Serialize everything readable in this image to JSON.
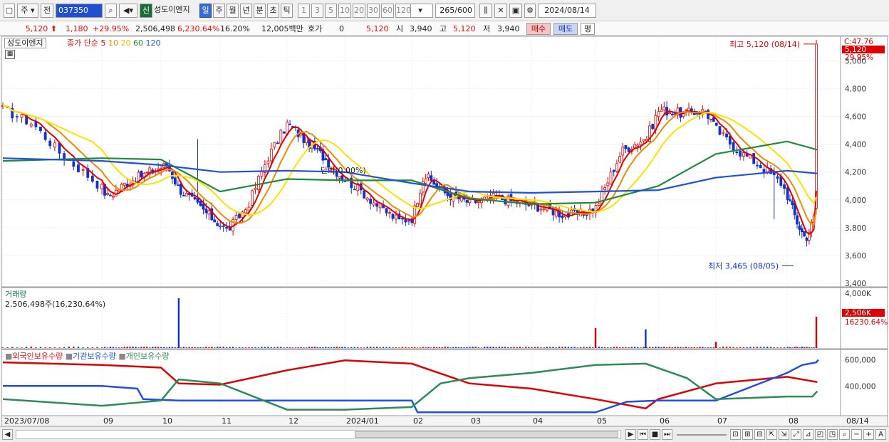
{
  "toolbar": {
    "type_label": "주",
    "prev_label": "전",
    "code_value": "037350",
    "new_badge": "신",
    "stock_name": "성도이엔지",
    "periods": [
      "일",
      "주",
      "월",
      "년",
      "분",
      "초",
      "틱"
    ],
    "active_period": "일",
    "intervals": [
      "1",
      "3",
      "5",
      "10",
      "20",
      "30",
      "60",
      "120"
    ],
    "count_value": "265",
    "count_total": "/600",
    "date_value": "2024/08/14"
  },
  "quote": {
    "price": "5,120",
    "change": "1,180",
    "change_pct": "+29.95%",
    "volume": "2,506,498",
    "volume_pct": "6,230.64%",
    "turnover": "16.20%",
    "amount": "12,005백만",
    "hoga_label": "호가",
    "hoga_value": "0",
    "hoga_price": "5,120",
    "open_label": "시",
    "open_value": "3,940",
    "high_label": "고",
    "high_value": "5,120",
    "low_label": "저",
    "low_value": "3,940",
    "buy_label": "매수",
    "sell_label": "매도",
    "avg_label": "평"
  },
  "price_panel": {
    "name_tag": "성도이엔지",
    "ma_prefix": "종가 단순",
    "ma_periods": [
      "5",
      "10",
      "20",
      "60",
      "120"
    ],
    "ma_colors": [
      "#e00000",
      "#f08a00",
      "#ffe000",
      "#1f8a3a",
      "#2050e0"
    ],
    "top_right_label": "C:47.76",
    "current_price_tag": "5,120",
    "current_pct_tag": "29.95%",
    "high_annotation": "최고 5,120 (08/14)",
    "low_annotation": "최저 3,465 (08/05)",
    "mid_annotation": "단락(0.00%)"
  },
  "volume_panel": {
    "label": "거래량",
    "info": "2,506,498주(16,230.64%)",
    "axis_label": "4,000K",
    "current_tag": "2,506K",
    "current_pct": "16230.64%"
  },
  "holding_panel": {
    "legend": [
      "외국인보유수량",
      "기관보유수량",
      "개인보유수량"
    ],
    "colors": [
      "#e00000",
      "#2050e0",
      "#2e8b57"
    ],
    "axis_labels": [
      "600,000",
      "400,000"
    ]
  },
  "x_axis": {
    "labels": [
      "2023/07/08",
      "09",
      "10",
      "11",
      "12",
      "2024/01",
      "02",
      "03",
      "04",
      "05",
      "06",
      "07",
      "08",
      "08/14"
    ]
  },
  "chart_data": {
    "type": "candlestick",
    "price_axis": {
      "ticks": [
        3400,
        3600,
        3800,
        4000,
        4200,
        4400,
        4600,
        4800,
        5000
      ],
      "ylim": [
        3380,
        5150
      ]
    },
    "months": [
      "2023/07/08",
      "09",
      "10",
      "11",
      "12",
      "2024/01",
      "02",
      "03",
      "04",
      "05",
      "06",
      "07",
      "08"
    ],
    "close_path": [
      [
        0,
        4650
      ],
      [
        0.3,
        4550
      ],
      [
        0.6,
        4320
      ],
      [
        0.9,
        4150
      ],
      [
        1.1,
        4020
      ],
      [
        1.4,
        4120
      ],
      [
        1.8,
        4200
      ],
      [
        2.1,
        4250
      ],
      [
        2.3,
        4080
      ],
      [
        2.7,
        3930
      ],
      [
        3.1,
        3780
      ],
      [
        3.4,
        3950
      ],
      [
        3.7,
        4300
      ],
      [
        4.0,
        4550
      ],
      [
        4.3,
        4430
      ],
      [
        4.6,
        4320
      ],
      [
        4.9,
        4180
      ],
      [
        5.2,
        4080
      ],
      [
        5.5,
        3950
      ],
      [
        5.8,
        3850
      ],
      [
        6.0,
        3870
      ],
      [
        6.2,
        4180
      ],
      [
        6.6,
        4040
      ],
      [
        7.0,
        3980
      ],
      [
        7.4,
        4020
      ],
      [
        7.8,
        3980
      ],
      [
        8.2,
        3940
      ],
      [
        8.5,
        3890
      ],
      [
        8.8,
        3900
      ],
      [
        9.0,
        3950
      ],
      [
        9.4,
        4350
      ],
      [
        9.8,
        4450
      ],
      [
        10.0,
        4650
      ],
      [
        10.4,
        4620
      ],
      [
        10.8,
        4640
      ],
      [
        11.0,
        4500
      ],
      [
        11.3,
        4350
      ],
      [
        11.6,
        4250
      ],
      [
        11.9,
        4120
      ],
      [
        12.2,
        3820
      ],
      [
        12.35,
        3720
      ],
      [
        12.5,
        3850
      ],
      [
        12.55,
        3940
      ],
      [
        12.58,
        5120
      ]
    ],
    "ma120_path": [
      [
        0,
        4300
      ],
      [
        1,
        4280
      ],
      [
        2,
        4250
      ],
      [
        3,
        4200
      ],
      [
        4,
        4210
      ],
      [
        5,
        4200
      ],
      [
        6,
        4120
      ],
      [
        7,
        4060
      ],
      [
        8,
        4050
      ],
      [
        9,
        4060
      ],
      [
        10,
        4070
      ],
      [
        11,
        4160
      ],
      [
        12,
        4210
      ],
      [
        12.6,
        4190
      ]
    ],
    "ma60_path": [
      [
        0,
        4280
      ],
      [
        1,
        4300
      ],
      [
        2,
        4290
      ],
      [
        3,
        4060
      ],
      [
        4,
        4150
      ],
      [
        5,
        4140
      ],
      [
        6,
        4140
      ],
      [
        7,
        4010
      ],
      [
        8,
        3970
      ],
      [
        9,
        3980
      ],
      [
        10,
        4100
      ],
      [
        11,
        4330
      ],
      [
        12,
        4420
      ],
      [
        12.6,
        4360
      ]
    ],
    "volume_spikes": [
      {
        "x": 2.3,
        "value": 4000,
        "color": "blue"
      },
      {
        "x": 9.0,
        "value": 1600,
        "color": "red"
      },
      {
        "x": 9.8,
        "value": 1500,
        "color": "blue"
      },
      {
        "x": 11.0,
        "value": 500,
        "color": "red"
      },
      {
        "x": 12.58,
        "value": 2506,
        "color": "red"
      }
    ],
    "foreign_holding": [
      [
        0,
        580000
      ],
      [
        1,
        560000
      ],
      [
        2,
        540000
      ],
      [
        2.3,
        420000
      ],
      [
        3,
        410000
      ],
      [
        4,
        520000
      ],
      [
        5,
        595000
      ],
      [
        6,
        570000
      ],
      [
        7,
        420000
      ],
      [
        8,
        380000
      ],
      [
        9,
        300000
      ],
      [
        9.8,
        230000
      ],
      [
        10,
        300000
      ],
      [
        11,
        420000
      ],
      [
        12,
        470000
      ],
      [
        12.6,
        430000
      ]
    ],
    "institution_holding": [
      [
        0,
        400000
      ],
      [
        1,
        400000
      ],
      [
        1.6,
        380000
      ],
      [
        1.7,
        300000
      ],
      [
        2.3,
        290000
      ],
      [
        6.0,
        290000
      ],
      [
        6.1,
        200000
      ],
      [
        9.0,
        200000
      ],
      [
        9.5,
        280000
      ],
      [
        10.0,
        290000
      ],
      [
        11.0,
        290000
      ],
      [
        12.0,
        500000
      ],
      [
        12.3,
        560000
      ],
      [
        12.58,
        580000
      ],
      [
        12.62,
        600000
      ]
    ],
    "retail_holding": [
      [
        0,
        300000
      ],
      [
        1,
        250000
      ],
      [
        2,
        290000
      ],
      [
        2.3,
        450000
      ],
      [
        3,
        420000
      ],
      [
        4,
        220000
      ],
      [
        5,
        220000
      ],
      [
        6,
        240000
      ],
      [
        6.5,
        420000
      ],
      [
        7,
        460000
      ],
      [
        8,
        500000
      ],
      [
        9,
        560000
      ],
      [
        9.8,
        570000
      ],
      [
        10.5,
        460000
      ],
      [
        11.0,
        300000
      ],
      [
        11.5,
        310000
      ],
      [
        12.0,
        320000
      ],
      [
        12.5,
        320000
      ],
      [
        12.6,
        360000
      ]
    ]
  }
}
